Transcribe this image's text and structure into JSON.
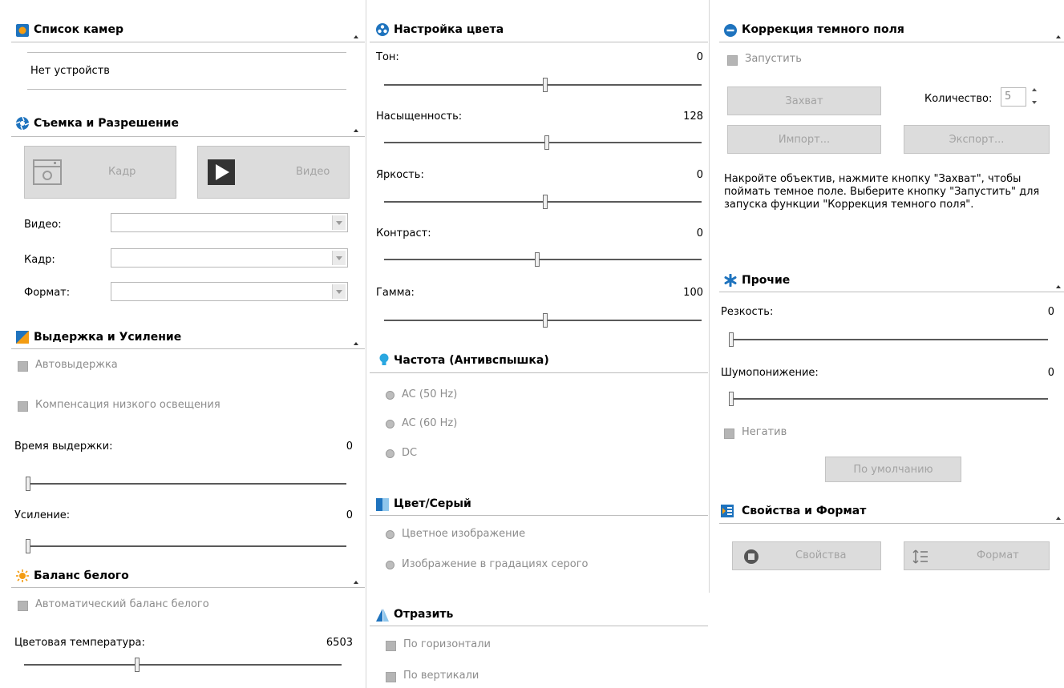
{
  "cameras": {
    "title": "Список камер",
    "empty": "Нет устройств"
  },
  "capture": {
    "title": "Съемка и Разрешение",
    "snap_label": "Кадр",
    "video_label": "Видео",
    "video_field_label": "Видео:",
    "frame_field_label": "Кадр:",
    "format_field_label": "Формат:"
  },
  "exposure": {
    "title": "Выдержка и Усиление",
    "auto_exposure": "Автовыдержка",
    "low_light": "Компенсация низкого освещения",
    "exposure_time_label": "Время выдержки:",
    "exposure_time_value": "0",
    "gain_label": "Усиление:",
    "gain_value": "0"
  },
  "white_balance": {
    "title": "Баланс белого",
    "auto_wb": "Автоматический баланс белого",
    "temp_label": "Цветовая температура:",
    "temp_value": "6503"
  },
  "color": {
    "title": "Настройка цвета",
    "hue_label": "Тон:",
    "hue_value": "0",
    "saturation_label": "Насыщенность:",
    "saturation_value": "128",
    "brightness_label": "Яркость:",
    "brightness_value": "0",
    "contrast_label": "Контраст:",
    "contrast_value": "0",
    "gamma_label": "Гамма:",
    "gamma_value": "100"
  },
  "frequency": {
    "title": "Частота (Антивспышка)",
    "ac50": "AC (50 Hz)",
    "ac60": "AC (60 Hz)",
    "dc": "DC"
  },
  "color_gray": {
    "title": "Цвет/Серый",
    "color_image": "Цветное изображение",
    "gray_image": "Изображение в градациях серого"
  },
  "flip": {
    "title": "Отразить",
    "horizontal": "По горизонтали",
    "vertical": "По вертикали"
  },
  "dark_field": {
    "title": "Коррекция темного поля",
    "start": "Запустить",
    "capture_button": "Захват",
    "count_label": "Количество:",
    "count_value": "5",
    "import_button": "Импорт...",
    "export_button": "Экспорт...",
    "hint": "Накройте объектив, нажмите кнопку \"Захват\", чтобы поймать темное поле. Выберите кнопку \"Запустить\" для запуска функции \"Коррекция темного поля\"."
  },
  "misc": {
    "title": "Прочие",
    "sharpness_label": "Резкость:",
    "sharpness_value": "0",
    "denoise_label": "Шумопонижение:",
    "denoise_value": "0",
    "negative": "Негатив",
    "default_button": "По умолчанию"
  },
  "props": {
    "title": "Свойства и Формат",
    "properties_button": "Свойства",
    "format_button": "Формат"
  },
  "colors": {
    "accent_blue": "#1e73be",
    "icon_orange": "#f39c12",
    "button_bg": "#dcdcdc",
    "disabled_text": "#8c8c8c"
  }
}
